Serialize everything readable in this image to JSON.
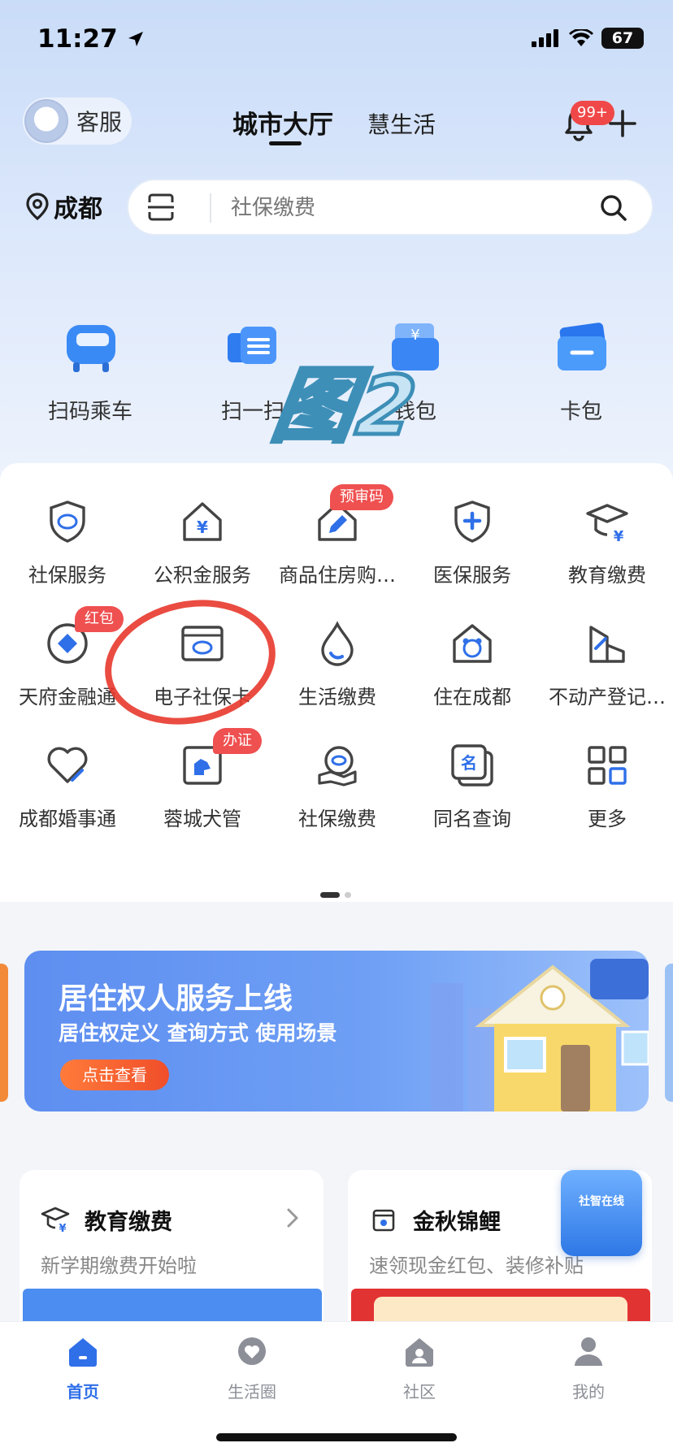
{
  "status": {
    "time": "11:27",
    "battery": "67"
  },
  "header": {
    "service_label": "客服",
    "tab_city": "城市大厅",
    "tab_life": "慧生活",
    "notification_badge": "99+"
  },
  "location": {
    "city": "成都"
  },
  "search": {
    "placeholder": "社保缴费"
  },
  "quick_actions": [
    {
      "label": "扫码乘车",
      "icon": "bus-icon"
    },
    {
      "label": "扫一扫",
      "icon": "scan-icon"
    },
    {
      "label": "钱包",
      "icon": "wallet-icon"
    },
    {
      "label": "卡包",
      "icon": "card-icon"
    }
  ],
  "watermark_text": "图2",
  "services": [
    {
      "label": "社保服务",
      "icon": "shield-icon"
    },
    {
      "label": "公积金服务",
      "icon": "house-yuan-icon"
    },
    {
      "label": "商品住房购…",
      "icon": "house-pen-icon",
      "badge": "预审码"
    },
    {
      "label": "医保服务",
      "icon": "medical-shield-icon"
    },
    {
      "label": "教育缴费",
      "icon": "graduation-icon"
    },
    {
      "label": "天府金融通",
      "icon": "diamond-icon",
      "badge": "红包"
    },
    {
      "label": "电子社保卡",
      "icon": "social-card-icon"
    },
    {
      "label": "生活缴费",
      "icon": "water-drop-icon"
    },
    {
      "label": "住在成都",
      "icon": "panda-house-icon"
    },
    {
      "label": "不动产登记…",
      "icon": "building-icon"
    },
    {
      "label": "成都婚事通",
      "icon": "heart-icon"
    },
    {
      "label": "蓉城犬管",
      "icon": "dog-icon",
      "badge": "办证"
    },
    {
      "label": "社保缴费",
      "icon": "social-pay-icon"
    },
    {
      "label": "同名查询",
      "icon": "name-card-icon"
    },
    {
      "label": "更多",
      "icon": "grid-more-icon"
    }
  ],
  "banner": {
    "title": "居住权人服务上线",
    "subtitle": "居住权定义  查询方式  使用场景",
    "button": "点击查看"
  },
  "cards": [
    {
      "title": "教育缴费",
      "subtitle": "新学期缴费开始啦"
    },
    {
      "title": "金秋锦鲤",
      "subtitle": "速领现金红包、装修补贴"
    }
  ],
  "float_promo": {
    "label": "社智在线"
  },
  "tabbar": [
    {
      "label": "首页",
      "icon": "home-icon",
      "active": true
    },
    {
      "label": "生活圈",
      "icon": "heart-bubble-icon"
    },
    {
      "label": "社区",
      "icon": "community-icon"
    },
    {
      "label": "我的",
      "icon": "user-icon"
    }
  ],
  "colors": {
    "accent": "#2f6fe8",
    "badge": "#ef5050",
    "annotation": "#e8392c"
  }
}
